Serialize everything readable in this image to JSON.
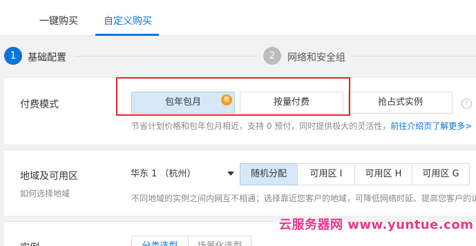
{
  "tabs": [
    {
      "label": "一键购买"
    },
    {
      "label": "自定义购买"
    }
  ],
  "steps": [
    {
      "number": "1",
      "label": "基础配置"
    },
    {
      "number": "2",
      "label": "网络和安全组"
    }
  ],
  "billing": {
    "label": "付费模式",
    "options": [
      {
        "label": "包年包月",
        "badge": "惠"
      },
      {
        "label": "按量付费"
      },
      {
        "label": "抢占式实例"
      }
    ],
    "help_icon": "?",
    "description": "节省计划价格和包年包月相近，支持 0 预付，同时提供极大的灵活性，",
    "link": "前往介绍页了解更多>"
  },
  "region": {
    "label": "地域及可用区",
    "help_link": "如何选择地域",
    "select_value": "华东 1 （杭州）",
    "zones": [
      "随机分配",
      "可用区 I",
      "可用区 H",
      "可用区 G"
    ],
    "description": "不同地域的实例之间内网互不相通；选择靠近您客户的地域，可降低网络时延、提高您客户的访"
  },
  "instance": {
    "label": "实例",
    "tabs": [
      "分类选型",
      "场景化选型"
    ]
  },
  "watermark": "云服务器网 www.yuntue.com",
  "colors": {
    "accent": "#0a74d8",
    "selected_bg": "#d6e8f7",
    "highlight": "#e0262b",
    "badge": "#f39c12",
    "watermark": "#e8368f"
  }
}
